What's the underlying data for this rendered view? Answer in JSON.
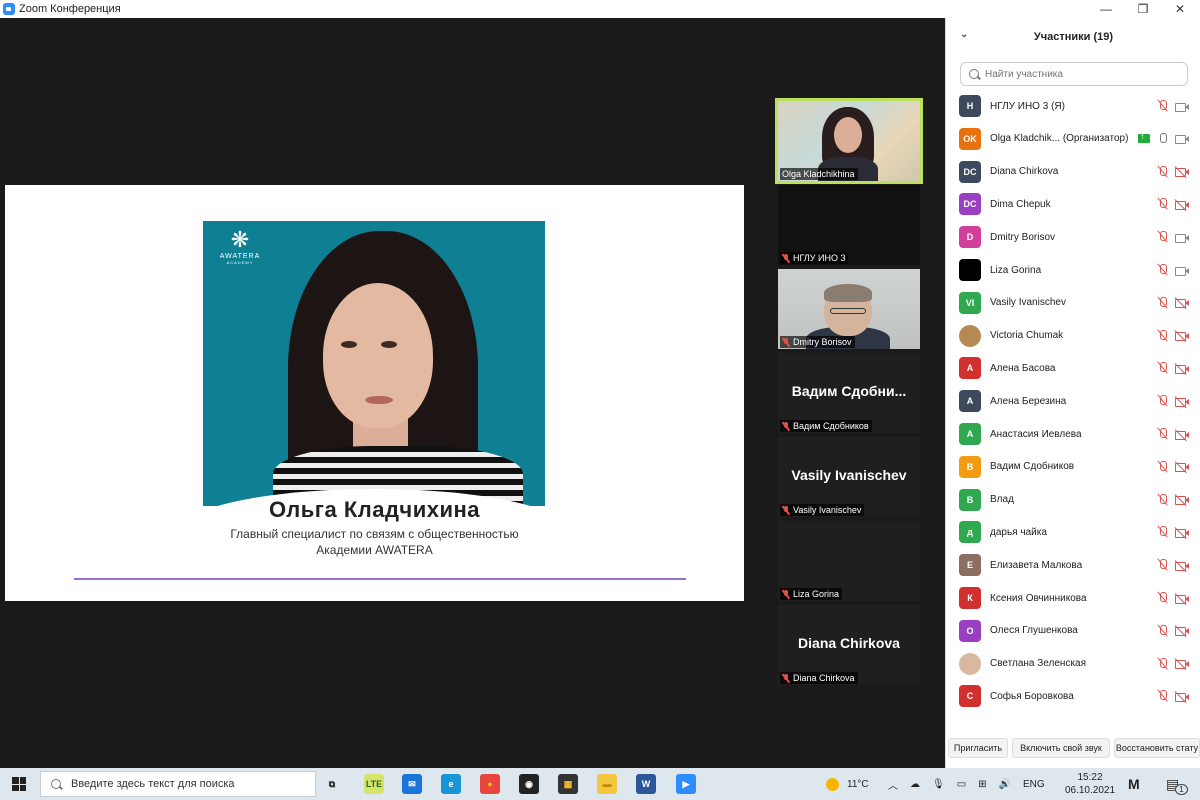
{
  "window": {
    "title": "Zoom Конференция",
    "minimize": "—",
    "restore": "❐",
    "close": "✕"
  },
  "slide": {
    "brand_name": "AWATERA",
    "brand_sub": "ACADEMY",
    "person_name": "Ольга Кладчихина",
    "role_line1": "Главный специалист по связям с общественностью",
    "role_line2": "Академии AWATERA"
  },
  "thumbnails": [
    {
      "label": "Olga Kladchikhina",
      "muted": false,
      "active": true,
      "kind": "video-woman"
    },
    {
      "label": "НГЛУ ИНО 3",
      "muted": true,
      "active": false,
      "kind": "dark"
    },
    {
      "label": "Dmitry Borisov",
      "muted": true,
      "active": false,
      "kind": "video-man"
    },
    {
      "label": "Вадим Сдобников",
      "big": "Вадим  Сдобни...",
      "muted": true,
      "kind": "name"
    },
    {
      "label": "Vasily Ivanischev",
      "big": "Vasily Ivanischev",
      "muted": true,
      "kind": "name"
    },
    {
      "label": "Liza Gorina",
      "muted": true,
      "kind": "blank"
    },
    {
      "label": "Diana Chirkova",
      "big": "Diana Chirkova",
      "muted": true,
      "kind": "name"
    }
  ],
  "participants_panel": {
    "title": "Участники (19)",
    "search_placeholder": "Найти участника",
    "participants": [
      {
        "initials": "Н",
        "name": "НГЛУ ИНО 3 (Я)",
        "color": "#3d4a5e",
        "mic": "off",
        "cam": "on"
      },
      {
        "initials": "OK",
        "name": "Olga Kladchik...  (Организатор)",
        "color": "#e8700f",
        "mic": "on",
        "cam": "on",
        "sharing": true
      },
      {
        "initials": "DC",
        "name": "Diana Chirkova",
        "color": "#3d4a5e",
        "mic": "off",
        "cam": "off"
      },
      {
        "initials": "DC",
        "name": "Dima Chepuk",
        "color": "#9b3fc2",
        "mic": "off",
        "cam": "off"
      },
      {
        "initials": "D",
        "name": "Dmitry Borisov",
        "color": "#d23f9a",
        "mic": "off",
        "cam": "on"
      },
      {
        "initials": "",
        "name": "Liza Gorina",
        "color": "#000000",
        "mic": "off",
        "cam": "on"
      },
      {
        "initials": "VI",
        "name": "Vasily Ivanischev",
        "color": "#2fa84f",
        "mic": "off",
        "cam": "off"
      },
      {
        "initials": "",
        "name": "Victoria Chumak",
        "color": "#b58a52",
        "mic": "off",
        "cam": "off",
        "photo": true
      },
      {
        "initials": "А",
        "name": "Алена Басова",
        "color": "#d22f2f",
        "mic": "off",
        "cam": "off"
      },
      {
        "initials": "А",
        "name": "Алена Березина",
        "color": "#3d4a5e",
        "mic": "off",
        "cam": "off"
      },
      {
        "initials": "А",
        "name": "Анастасия Иевлева",
        "color": "#2fa84f",
        "mic": "off",
        "cam": "off"
      },
      {
        "initials": "В",
        "name": "Вадим Сдобников",
        "color": "#f39c12",
        "mic": "off",
        "cam": "off"
      },
      {
        "initials": "В",
        "name": "Влад",
        "color": "#2fa84f",
        "mic": "off",
        "cam": "off"
      },
      {
        "initials": "д",
        "name": "дарья чайка",
        "color": "#2fa84f",
        "mic": "off",
        "cam": "off"
      },
      {
        "initials": "Е",
        "name": "Елизавета Малкова",
        "color": "#8d6e63",
        "mic": "off",
        "cam": "off"
      },
      {
        "initials": "К",
        "name": "Ксения Овчинникова",
        "color": "#d22f2f",
        "mic": "off",
        "cam": "off"
      },
      {
        "initials": "О",
        "name": "Олеся Глушенкова",
        "color": "#9b3fc2",
        "mic": "off",
        "cam": "off"
      },
      {
        "initials": "",
        "name": "Светлана Зеленская",
        "color": "#d9b8a0",
        "mic": "off",
        "cam": "off",
        "photo": true
      },
      {
        "initials": "С",
        "name": "Софья Боровкова",
        "color": "#d22f2f",
        "mic": "off",
        "cam": "off"
      }
    ],
    "footer_buttons": [
      "Пригласить",
      "Включить свой звук",
      "Восстановить стату"
    ]
  },
  "taskbar": {
    "search_placeholder": "Введите здесь текст для поиска",
    "weather": "11°C",
    "lang": "ENG",
    "time": "15:22",
    "date": "06.10.2021",
    "notifications": "1",
    "apps": [
      {
        "name": "task-view-icon",
        "label": "⧉",
        "color": "#dfe7ee",
        "fg": "#222"
      },
      {
        "name": "lte-app-icon",
        "label": "LTE",
        "color": "#d7e46b",
        "fg": "#2a6a1f"
      },
      {
        "name": "mail-icon",
        "label": "✉",
        "color": "#1b74d8",
        "fg": "#fff"
      },
      {
        "name": "edge-icon",
        "label": "e",
        "color": "#1795d6",
        "fg": "#fff"
      },
      {
        "name": "chrome-icon",
        "label": "●",
        "color": "#e8453c",
        "fg": "#fbbc05"
      },
      {
        "name": "obs-icon",
        "label": "◉",
        "color": "#222",
        "fg": "#fff"
      },
      {
        "name": "store-icon",
        "label": "▦",
        "color": "#333",
        "fg": "#f7c02c"
      },
      {
        "name": "explorer-icon",
        "label": "▬",
        "color": "#f3c63f",
        "fg": "#c48a00"
      },
      {
        "name": "word-icon",
        "label": "W",
        "color": "#2b579a",
        "fg": "#fff"
      },
      {
        "name": "zoom-icon",
        "label": "▶",
        "color": "#2d8cff",
        "fg": "#fff"
      }
    ]
  }
}
